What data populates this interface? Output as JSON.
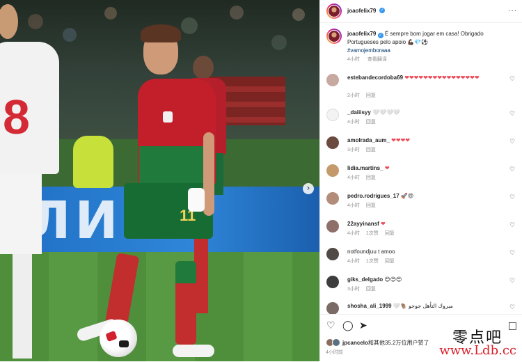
{
  "post": {
    "author": "joaofelix79",
    "caption": {
      "username": "joaofelix79",
      "text": "É sempre bom jogar em casa! Obrigado Portugueses pelo apoio 💪🏿💎⚽",
      "hashtag": "#vamojemboraaa",
      "time": "4小时",
      "see_translation": "查看翻译"
    },
    "photo": {
      "board_text": "ЛИН",
      "shirt_number": "8",
      "player_number": "11"
    },
    "comments": [
      {
        "user": "estebandecordoba69",
        "text": "❤❤❤❤❤❤❤❤❤❤❤❤❤❤❤❤",
        "time": "2小时",
        "reply": "回复",
        "avatar": "#c7a9a0"
      },
      {
        "user": "_daiiisyy",
        "text": "🤍🤍🤍🤍",
        "time": "4小时",
        "reply": "回复",
        "avatar": "#dbdbdb"
      },
      {
        "user": "amolrada_aum_",
        "text": "❤❤❤❤",
        "time": "3小时",
        "reply": "回复",
        "avatar": "#6b4b3f"
      },
      {
        "user": "lidia.martins_",
        "text": "❤",
        "time": "4小时",
        "reply": "回复",
        "avatar": "#c49a6c"
      },
      {
        "user": "pedro.rodrigues_17",
        "text": "🚀😍",
        "time": "4小时",
        "reply": "回复",
        "avatar": "#b38c7a"
      },
      {
        "user": "22ayyinansf",
        "text": "❤",
        "time": "4小时",
        "likes": "1次赞",
        "reply": "回复",
        "avatar": "#8e6f6a"
      },
      {
        "user": "notfoundjuu",
        "text": "t amoo",
        "time": "4小时",
        "likes": "1次赞",
        "reply": "回复",
        "avatar": "#4f4a45"
      },
      {
        "user": "giks_delgado",
        "text": "😍😍😍",
        "time": "3小时",
        "reply": "回复",
        "avatar": "#3d3d3d"
      },
      {
        "user": "shosha_ali_1999",
        "text": "🤍🐐 مبروك التأهل جوجو",
        "avatar": "#7a6b66"
      }
    ],
    "actions": {
      "like": "like",
      "comment": "comment",
      "share": "share",
      "save": "save"
    },
    "likes_line": {
      "name": "jpcancelo",
      "rest": "和其他35.2万位用户赞了"
    },
    "time": "4小时前"
  },
  "watermark": {
    "cn": "零点吧",
    "url": "www.Ldb.cc"
  },
  "colors": {
    "verified": "#3897f0",
    "heart_red": "#ed4956",
    "hashtag": "#00376b",
    "watermark_red": "#d8202a"
  }
}
